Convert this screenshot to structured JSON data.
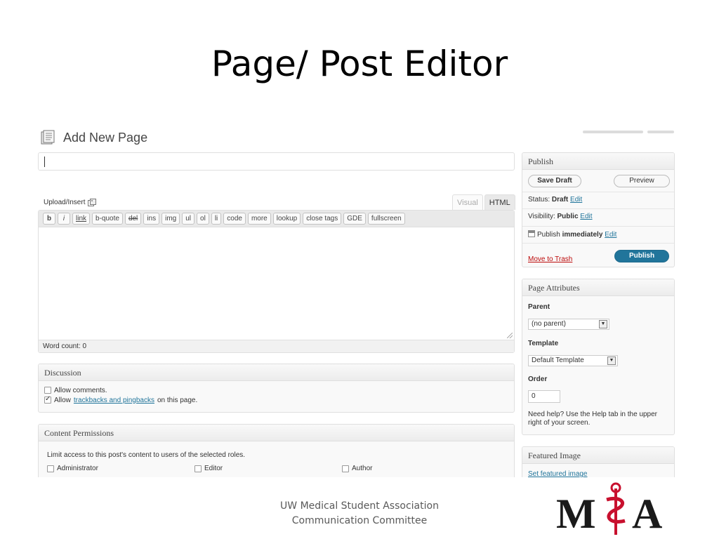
{
  "slide": {
    "title": "Page/ Post Editor",
    "footer_line1": "UW Medical Student Association",
    "footer_line2": "Communication Committee",
    "logo_text": "MSA"
  },
  "editor": {
    "page_heading": "Add New Page",
    "title_value": "",
    "upload_label": "Upload/Insert",
    "tabs": [
      {
        "label": "Visual",
        "active": false
      },
      {
        "label": "HTML",
        "active": true
      }
    ],
    "quicktags": [
      "b",
      "i",
      "link",
      "b-quote",
      "del",
      "ins",
      "img",
      "ul",
      "ol",
      "li",
      "code",
      "more",
      "lookup",
      "close tags",
      "GDE",
      "fullscreen"
    ],
    "word_count": "Word count: 0"
  },
  "discussion": {
    "title": "Discussion",
    "allow_comments": "Allow comments.",
    "allow_prefix": "Allow",
    "trackbacks_link": "trackbacks and pingbacks",
    "allow_suffix": "on this page.",
    "comments_checked": false,
    "trackbacks_checked": true
  },
  "permissions": {
    "title": "Content Permissions",
    "description": "Limit access to this post's content to users of the selected roles.",
    "roles": [
      "Administrator",
      "Editor",
      "Author"
    ]
  },
  "publish": {
    "title": "Publish",
    "save_draft": "Save Draft",
    "preview": "Preview",
    "status_label": "Status:",
    "status_value": "Draft",
    "visibility_label": "Visibility:",
    "visibility_value": "Public",
    "publish_label": "Publish",
    "publish_value": "immediately",
    "edit": "Edit",
    "move_to_trash": "Move to Trash",
    "publish_button": "Publish"
  },
  "attributes": {
    "title": "Page Attributes",
    "parent_label": "Parent",
    "parent_value": "(no parent)",
    "template_label": "Template",
    "template_value": "Default Template",
    "order_label": "Order",
    "order_value": "0",
    "help_text": "Need help? Use the Help tab in the upper right of your screen."
  },
  "featured": {
    "title": "Featured Image",
    "link": "Set featured image"
  },
  "colors": {
    "link": "#21759b",
    "publish_button": "#21759b",
    "trash": "#bc0b0b",
    "logo_dark": "#1a1a1a",
    "logo_red": "#c8102e"
  }
}
